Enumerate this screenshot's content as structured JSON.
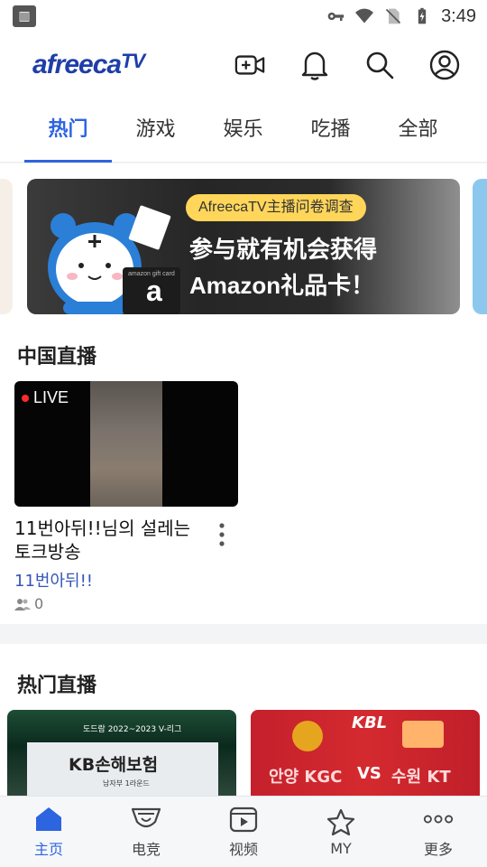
{
  "status_bar": {
    "time": "3:49"
  },
  "app": {
    "logo_main": "afreeca",
    "logo_suffix": "TV"
  },
  "header_actions": {
    "go_live": "video-camera-add-icon",
    "notifications": "bell-icon",
    "search": "search-icon",
    "profile": "profile-icon"
  },
  "tabs": [
    {
      "label": "热门",
      "active": true
    },
    {
      "label": "游戏",
      "active": false
    },
    {
      "label": "娱乐",
      "active": false
    },
    {
      "label": "吃播",
      "active": false
    },
    {
      "label": "全部",
      "active": false
    }
  ],
  "banner": {
    "pill": "AfreecaTV主播问卷调查",
    "line1": "参与就有机会获得",
    "line2": "Amazon礼品卡！",
    "giftcard_brand": "a",
    "giftcard_small": "amazon gift card"
  },
  "china_live": {
    "title": "中国直播",
    "stream": {
      "badge": "LIVE",
      "title": "11번아뒤!!님의 설레는 토크방송",
      "streamer": "11번아뒤!!",
      "viewers": "0"
    }
  },
  "hot_live": {
    "title": "热门直播",
    "cards": [
      {
        "top_caption": "도드람 2022~2023 V-리그",
        "team": "KB손해보험",
        "round": "남자부 1라운드"
      },
      {
        "logo": "KBL",
        "home": "안양 KGC",
        "vs": "VS",
        "away": "수원 KT"
      }
    ]
  },
  "bottom_nav": [
    {
      "label": "主页",
      "icon": "home-icon",
      "active": true
    },
    {
      "label": "电竞",
      "icon": "trophy-icon",
      "active": false
    },
    {
      "label": "视频",
      "icon": "video-play-icon",
      "active": false
    },
    {
      "label": "MY",
      "icon": "star-icon",
      "active": false
    },
    {
      "label": "更多",
      "icon": "more-horizontal-icon",
      "active": false
    }
  ],
  "colors": {
    "accent": "#2d64e0",
    "logo": "#1f3ea8",
    "streamer_name": "#3555b8"
  }
}
